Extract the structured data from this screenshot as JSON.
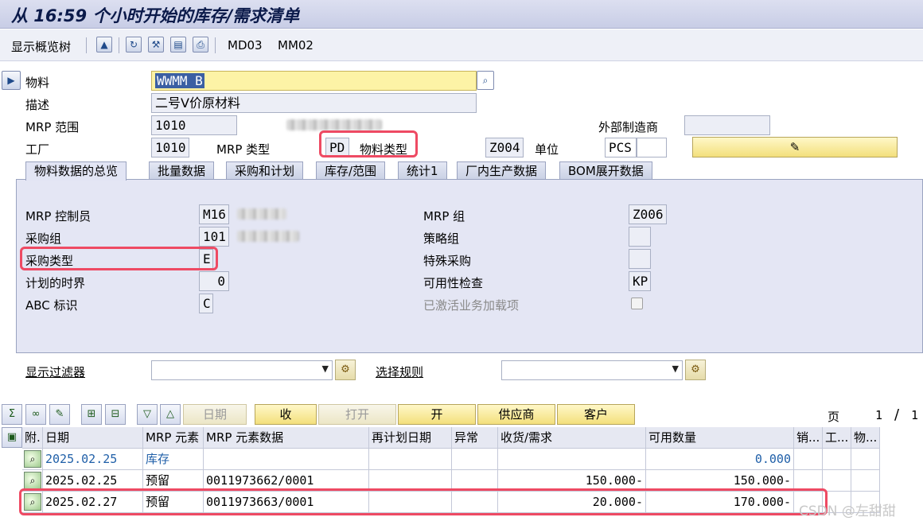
{
  "window": {
    "title": "从 16:59 个小时开始的库存/需求清单"
  },
  "toolbar": {
    "overview_tree": "显示概览树",
    "md03": "MD03",
    "mm02": "MM02"
  },
  "header": {
    "material_label": "物料",
    "material_value": "WWMM B",
    "description_label": "描述",
    "description_value": "二号V价原材料",
    "mrp_area_label": "MRP 范围",
    "mrp_area_value": "1010",
    "plant_label": "工厂",
    "plant_value": "1010",
    "mrp_type_label": "MRP 类型",
    "mrp_type_value": "PD",
    "material_type_label": "物料类型",
    "material_type_value": "Z004",
    "unit_label": "单位",
    "unit_value": "PCS",
    "ext_manufacturer_label": "外部制造商"
  },
  "tabs": [
    "物料数据的总览",
    "批量数据",
    "采购和计划",
    "库存/范围",
    "统计1",
    "厂内生产数据",
    "BOM展开数据"
  ],
  "overview": {
    "mrp_controller_label": "MRP 控制员",
    "mrp_controller_value": "M16",
    "purchasing_group_label": "采购组",
    "purchasing_group_value": "101",
    "procurement_type_label": "采购类型",
    "procurement_type_value": "E",
    "planning_horizon_label": "计划的时界",
    "planning_horizon_value": "0",
    "abc_label": "ABC 标识",
    "abc_value": "C",
    "mrp_group_label": "MRP 组",
    "mrp_group_value": "Z006",
    "strategy_group_label": "策略组",
    "special_procurement_label": "特殊采购",
    "availability_check_label": "可用性检查",
    "availability_check_value": "KP",
    "deactivated_label": "已激活业务加载项"
  },
  "filters": {
    "display_filter_label": "显示过滤器",
    "selection_rule_label": "选择规则"
  },
  "grid_toolbar": {
    "date_btn": "日期",
    "receipt_btn": "收",
    "open_btn": "打开",
    "open2_btn": "开",
    "vendor_btn": "供应商",
    "customer_btn": "客户",
    "page_label": "页",
    "page_current": "1",
    "page_sep": "/",
    "page_total": "1"
  },
  "table": {
    "headers": [
      "附.",
      "日期",
      "MRP 元素",
      "MRP 元素数据",
      "再计划日期",
      "异常",
      "收货/需求",
      "可用数量",
      "销...",
      "工...",
      "物..."
    ],
    "rows": [
      {
        "date": "2025.02.25",
        "element": "库存",
        "element_data": "",
        "qty": "",
        "available": "0.000"
      },
      {
        "date": "2025.02.25",
        "element": "预留",
        "element_data": "0011973662/0001",
        "qty": "150.000-",
        "available": "150.000-"
      },
      {
        "date": "2025.02.27",
        "element": "预留",
        "element_data": "0011973663/0001",
        "qty": "20.000-",
        "available": "170.000-"
      }
    ]
  },
  "watermark": "CSDN @左甜甜",
  "colors": {
    "highlight": "#ee4a63",
    "stock_text": "#1f5fa8"
  }
}
